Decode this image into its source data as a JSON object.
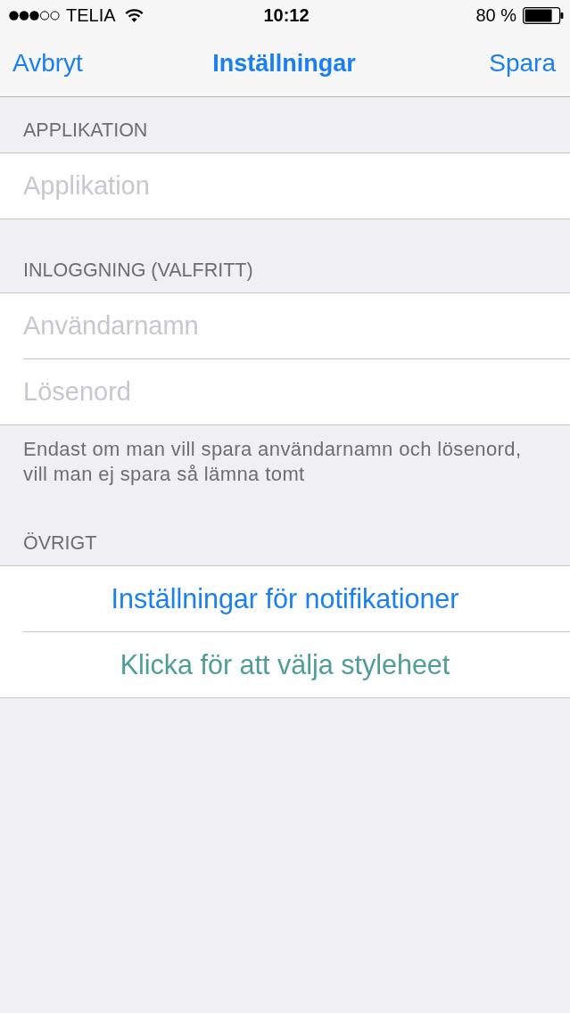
{
  "status_bar": {
    "carrier": "TELIA",
    "time": "10:12",
    "battery": "80 %"
  },
  "nav_bar": {
    "left_button": "Avbryt",
    "title": "Inställningar",
    "right_button": "Spara"
  },
  "sections": [
    {
      "header": "APPLIKATION",
      "rows": [
        {
          "kind": "field",
          "placeholder": "Applikation"
        }
      ]
    },
    {
      "header": "INLOGGNING (VALFRITT)",
      "rows": [
        {
          "kind": "field",
          "placeholder": "Användarnamn"
        },
        {
          "kind": "field",
          "placeholder": "Lösenord"
        }
      ],
      "footer": "Endast om man vill spara användarnamn och lösenord, vill man ej spara så lämna tomt"
    },
    {
      "header": "ÖVRIGT",
      "rows": [
        {
          "kind": "action",
          "label": "Inställningar för notifikationer",
          "color": "#1a7ff0"
        },
        {
          "kind": "action",
          "label": "Klicka för att välja styleheet",
          "color": "#4f9d97"
        }
      ]
    }
  ]
}
